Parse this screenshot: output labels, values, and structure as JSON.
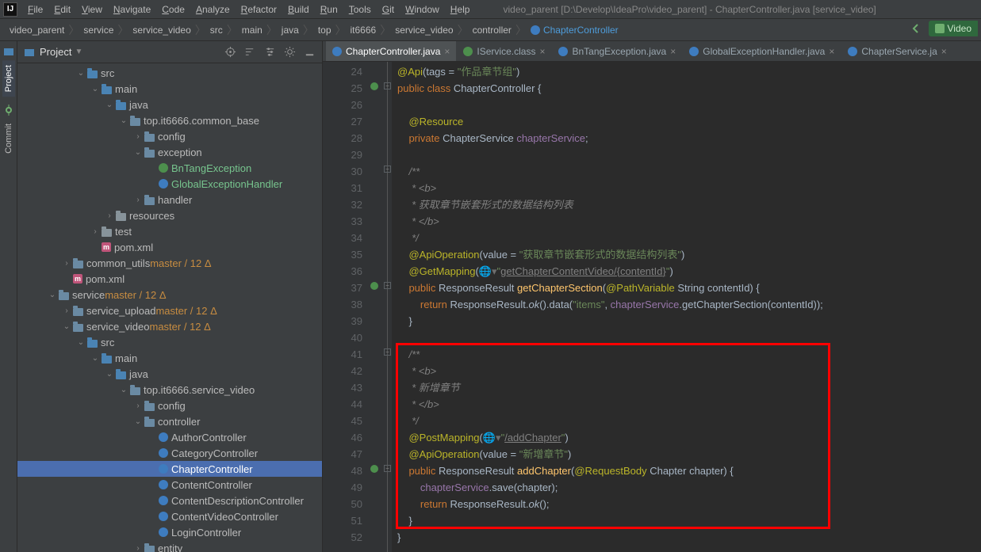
{
  "menu": {
    "items": [
      "File",
      "Edit",
      "View",
      "Navigate",
      "Code",
      "Analyze",
      "Refactor",
      "Build",
      "Run",
      "Tools",
      "Git",
      "Window",
      "Help"
    ]
  },
  "title": "video_parent [D:\\Develop\\IdeaPro\\video_parent] - ChapterController.java [service_video]",
  "breadcrumbs": [
    "video_parent",
    "service",
    "service_video",
    "src",
    "main",
    "java",
    "top",
    "it6666",
    "service_video",
    "controller",
    "ChapterController"
  ],
  "nav_right_label": "Video",
  "toolwin": {
    "title": "Project",
    "icons": [
      "target-icon",
      "sort-icon",
      "filter-icon",
      "gear-icon",
      "minimize-icon"
    ]
  },
  "tree": [
    {
      "d": 4,
      "c": "v",
      "i": "folder-blue",
      "t": "src"
    },
    {
      "d": 5,
      "c": "v",
      "i": "folder-blue",
      "t": "main"
    },
    {
      "d": 6,
      "c": "v",
      "i": "folder-blue",
      "t": "java"
    },
    {
      "d": 7,
      "c": "v",
      "i": "pkg",
      "t": "top.it6666.common_base"
    },
    {
      "d": 8,
      "c": ">",
      "i": "pkg",
      "t": "config"
    },
    {
      "d": 8,
      "c": "v",
      "i": "pkg",
      "t": "exception"
    },
    {
      "d": 9,
      "c": "",
      "i": "cls-g",
      "t": "BnTangException",
      "cls": "kind-class"
    },
    {
      "d": 9,
      "c": "",
      "i": "cls-b",
      "t": "GlobalExceptionHandler",
      "cls": "kind-class"
    },
    {
      "d": 8,
      "c": ">",
      "i": "pkg",
      "t": "handler"
    },
    {
      "d": 6,
      "c": ">",
      "i": "folder",
      "t": "resources"
    },
    {
      "d": 5,
      "c": ">",
      "i": "folder",
      "t": "test"
    },
    {
      "d": 5,
      "c": "",
      "i": "m",
      "t": "pom.xml"
    },
    {
      "d": 3,
      "c": ">",
      "i": "folder-bluegray",
      "t": "common_utils",
      "suffix": " master / 12 Δ",
      "sc": "orange"
    },
    {
      "d": 3,
      "c": "",
      "i": "m",
      "t": "pom.xml"
    },
    {
      "d": 2,
      "c": "v",
      "i": "folder-bluegray",
      "t": "service",
      "suffix": " master / 12 Δ",
      "sc": "orange"
    },
    {
      "d": 3,
      "c": ">",
      "i": "folder-bluegray",
      "t": "service_upload",
      "suffix": " master / 12 Δ",
      "sc": "orange"
    },
    {
      "d": 3,
      "c": "v",
      "i": "folder-bluegray",
      "t": "service_video",
      "suffix": " master / 12 Δ",
      "sc": "orange"
    },
    {
      "d": 4,
      "c": "v",
      "i": "folder-blue",
      "t": "src"
    },
    {
      "d": 5,
      "c": "v",
      "i": "folder-blue",
      "t": "main"
    },
    {
      "d": 6,
      "c": "v",
      "i": "folder-blue",
      "t": "java"
    },
    {
      "d": 7,
      "c": "v",
      "i": "pkg",
      "t": "top.it6666.service_video"
    },
    {
      "d": 8,
      "c": ">",
      "i": "pkg",
      "t": "config"
    },
    {
      "d": 8,
      "c": "v",
      "i": "pkg",
      "t": "controller"
    },
    {
      "d": 9,
      "c": "",
      "i": "cls-b",
      "t": "AuthorController"
    },
    {
      "d": 9,
      "c": "",
      "i": "cls-b",
      "t": "CategoryController"
    },
    {
      "d": 9,
      "c": "",
      "i": "cls-b",
      "t": "ChapterController",
      "sel": true
    },
    {
      "d": 9,
      "c": "",
      "i": "cls-b",
      "t": "ContentController"
    },
    {
      "d": 9,
      "c": "",
      "i": "cls-b",
      "t": "ContentDescriptionController"
    },
    {
      "d": 9,
      "c": "",
      "i": "cls-b",
      "t": "ContentVideoController"
    },
    {
      "d": 9,
      "c": "",
      "i": "cls-b",
      "t": "LoginController"
    },
    {
      "d": 8,
      "c": ">",
      "i": "pkg",
      "t": "entity"
    }
  ],
  "tabs": [
    {
      "i": "c",
      "t": "ChapterController.java",
      "active": true
    },
    {
      "i": "i",
      "t": "IService.class"
    },
    {
      "i": "c",
      "t": "BnTangException.java"
    },
    {
      "i": "c",
      "t": "GlobalExceptionHandler.java"
    },
    {
      "i": "c",
      "t": "ChapterService.ja"
    }
  ],
  "code": {
    "first_line": 24,
    "lines": [
      "<span class='c-ann'>@Api</span>(tags = <span class='c-str'>\"作品章节组\"</span>)",
      "<span class='c-kw'>public class </span><span class='c-cls'>ChapterController</span> {",
      "",
      "    <span class='c-ann'>@Resource</span>",
      "    <span class='c-kw'>private</span> ChapterService <span class='c-fld'>chapterService</span>;",
      "",
      "    <span class='c-cmt'>/**</span>",
      "    <span class='c-cmt'> * &lt;b&gt;</span>",
      "    <span class='c-cmt'> * 获取章节嵌套形式的数据结构列表</span>",
      "    <span class='c-cmt'> * &lt;/b&gt;</span>",
      "    <span class='c-cmt'> */</span>",
      "    <span class='c-ann'>@ApiOperation</span>(value = <span class='c-str'>\"获取章节嵌套形式的数据结构列表\"</span>)",
      "    <span class='c-ann'>@GetMapping</span>(<span class='c-globe'>&#x1F310;&#x25BE;</span><span class='c-str'>\"</span><span class='c-url'>getChapterContentVideo/{contentId}</span><span class='c-str'>\"</span>)",
      "    <span class='c-kw'>public</span> ResponseResult <span class='c-mtd'>getChapterSection</span>(<span class='c-ann'>@PathVariable</span> String contentId) {",
      "        <span class='c-kw'>return</span> ResponseResult.<i>ok</i>().data(<span class='c-str'>\"items\"</span>, <span class='c-fld'>chapterService</span>.getChapterSection(contentId));",
      "    }",
      "",
      "    <span class='c-cmt'>/**</span>",
      "    <span class='c-cmt'> * &lt;b&gt;</span>",
      "    <span class='c-cmt'> * 新增章节</span>",
      "    <span class='c-cmt'> * &lt;/b&gt;</span>",
      "    <span class='c-cmt'> */</span>",
      "    <span class='c-ann'>@PostMapping</span>(<span class='c-globe'>&#x1F310;&#x25BE;</span><span class='c-str'>\"</span><span class='c-url'>/addChapter</span><span class='c-str'>\"</span>)",
      "    <span class='c-ann'>@ApiOperation</span>(value = <span class='c-str'>\"新增章节\"</span>)",
      "    <span class='c-kw'>public</span> ResponseResult <span class='c-mtd'>addChapter</span>(<span class='c-ann'>@RequestBody</span> Chapter chapter) {",
      "        <span class='c-fld'>chapterService</span>.save(chapter);",
      "        <span class='c-kw'>return</span> ResponseResult.<i>ok</i>();",
      "    }",
      "}"
    ]
  },
  "side_tabs": [
    "Project",
    "Commit"
  ],
  "red_box": {
    "top_line": 41,
    "bottom_line": 51
  }
}
